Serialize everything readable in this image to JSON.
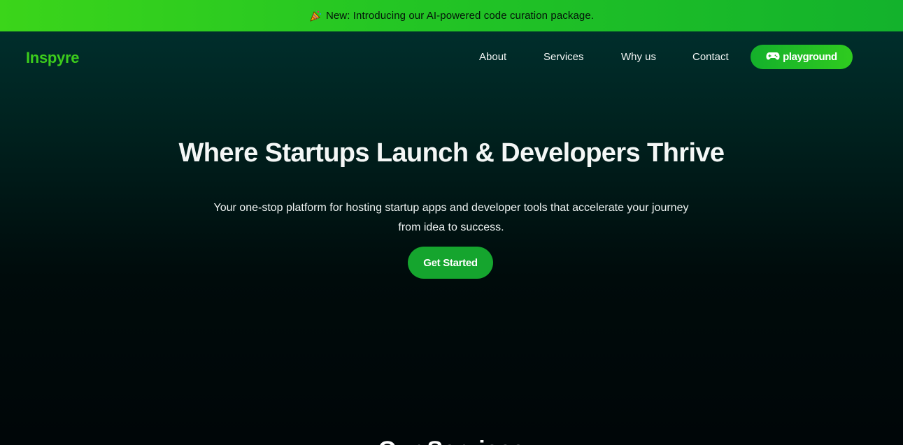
{
  "announcement": {
    "icon": "party-popper-icon",
    "text": "New: Introducing our AI-powered code curation package."
  },
  "nav": {
    "logo": "Inspyre",
    "links": [
      "About",
      "Services",
      "Why us",
      "Contact"
    ],
    "playground": {
      "icon": "gamepad-icon",
      "label": "playground"
    }
  },
  "hero": {
    "title": "Where Startups Launch & Developers Thrive",
    "subtitle": "Your one-stop platform for hosting startup apps and developer tools that accelerate your journey from idea to success.",
    "cta": "Get Started"
  },
  "next_section": {
    "heading_partial": "Our Services"
  },
  "colors": {
    "accent": "#2fcb1f",
    "button": "#15a52e",
    "logo": "#3ccc1c"
  }
}
